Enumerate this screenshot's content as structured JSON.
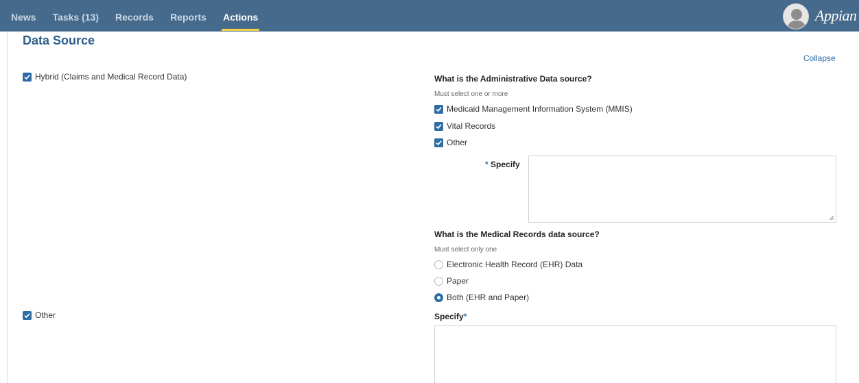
{
  "nav": {
    "tabs": [
      {
        "label": "News"
      },
      {
        "label": "Tasks (13)"
      },
      {
        "label": "Records"
      },
      {
        "label": "Reports"
      },
      {
        "label": "Actions"
      }
    ],
    "active_index": 4,
    "brand": "Appian"
  },
  "section": {
    "title": "Data Source",
    "collapse_label": "Collapse"
  },
  "left": {
    "hybrid_label": "Hybrid (Claims and Medical Record Data)",
    "hybrid_checked": true,
    "other_label": "Other",
    "other_checked": true
  },
  "admin": {
    "question": "What is the Administrative Data source?",
    "hint": "Must select one or more",
    "options": [
      {
        "label": "Medicaid Management Information System (MMIS)",
        "checked": true
      },
      {
        "label": "Vital Records",
        "checked": true
      },
      {
        "label": "Other",
        "checked": true
      }
    ],
    "specify_required_mark": "*",
    "specify_label": "Specify",
    "specify_value": ""
  },
  "medical": {
    "question": "What is the Medical Records data source?",
    "hint": "Must select only one",
    "options": [
      {
        "label": "Electronic Health Record (EHR) Data",
        "selected": false
      },
      {
        "label": "Paper",
        "selected": false
      },
      {
        "label": "Both (EHR and Paper)",
        "selected": true
      }
    ]
  },
  "other_specify": {
    "label": "Specify",
    "required_mark": "*",
    "value": ""
  },
  "colors": {
    "topbar": "#466a8b",
    "active_underline": "#f3d34a",
    "accent": "#2f6ca4",
    "title": "#2d5f8a"
  }
}
